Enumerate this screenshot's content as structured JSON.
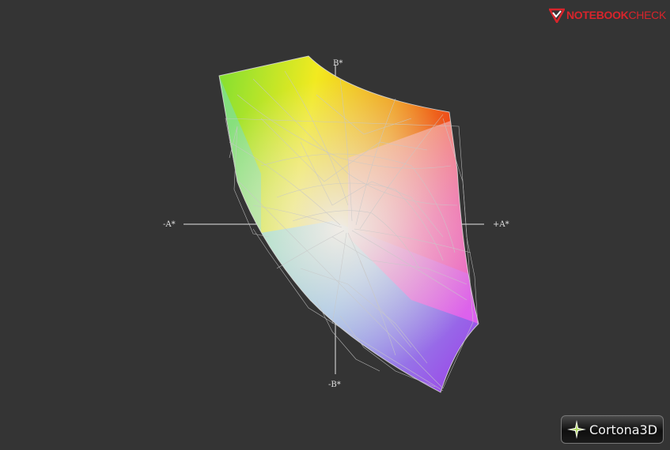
{
  "viewer": {
    "brand_logo": {
      "part1": "NOTEBOOK",
      "part2": "CHECK",
      "color": "#d9242b"
    },
    "axes": {
      "b_plus": "B*",
      "a_minus": "-A*",
      "a_plus": "+A*",
      "b_minus": "-B*"
    },
    "badge": {
      "label": "Cortona3D",
      "icon": "cortona-star-icon"
    },
    "colors": {
      "background": "#343434",
      "axis_line": "#e6e6e6",
      "wireframe": "#c8c8c8"
    }
  }
}
